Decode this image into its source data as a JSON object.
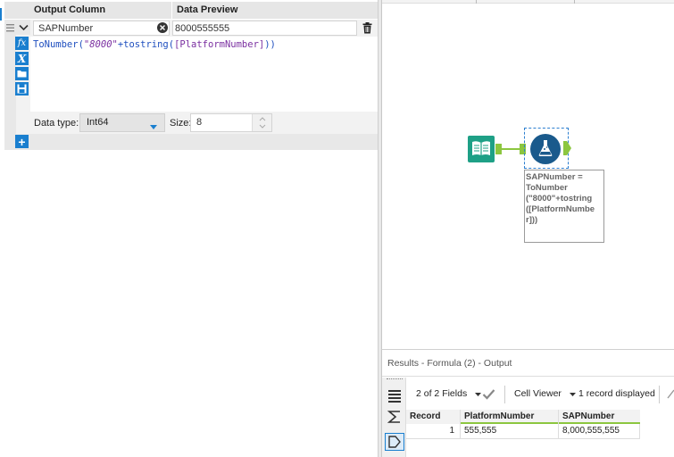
{
  "formula": {
    "headers": {
      "output_column": "Output Column",
      "data_preview": "Data Preview"
    },
    "row": {
      "column_name": "SAPNumber",
      "preview_value": "8000555555",
      "expression_parts": [
        {
          "text": "ToNumber(",
          "color": "#1f4fbf"
        },
        {
          "text": "\"8000\"",
          "color": "#7a2fa0",
          "italic": true
        },
        {
          "text": "+tostring(",
          "color": "#1f4fbf"
        },
        {
          "text": "[PlatformNumber]",
          "color": "#7a2fa0"
        },
        {
          "text": "))",
          "color": "#1f4fbf"
        }
      ],
      "data_type_label": "Data type:",
      "data_type_value": "Int64",
      "size_label": "Size:",
      "size_value": "8"
    },
    "side_icons": [
      "fx-icon",
      "variable-x-icon",
      "folder-icon",
      "save-icon"
    ],
    "add_icon": "plus-icon"
  },
  "canvas": {
    "tool_annotation": "SAPNumber =\nToNumber\n(\"8000\"+tostring\n([PlatformNumbe\nr]))",
    "input_icon": "book-icon",
    "formula_icon": "flask-icon",
    "connector_color": "#8cc63f",
    "brand_teal": "#1ea086",
    "brand_navy": "#1a5a8c"
  },
  "results": {
    "title": "Results - Formula (2) - Output",
    "fields_count": "2 of 2 Fields",
    "viewer": "Cell Viewer",
    "records_displayed": "1 record displayed",
    "columns": [
      "Record",
      "PlatformNumber",
      "SAPNumber"
    ],
    "rows": [
      [
        "1",
        "555,555",
        "8,000,555,555"
      ]
    ]
  }
}
